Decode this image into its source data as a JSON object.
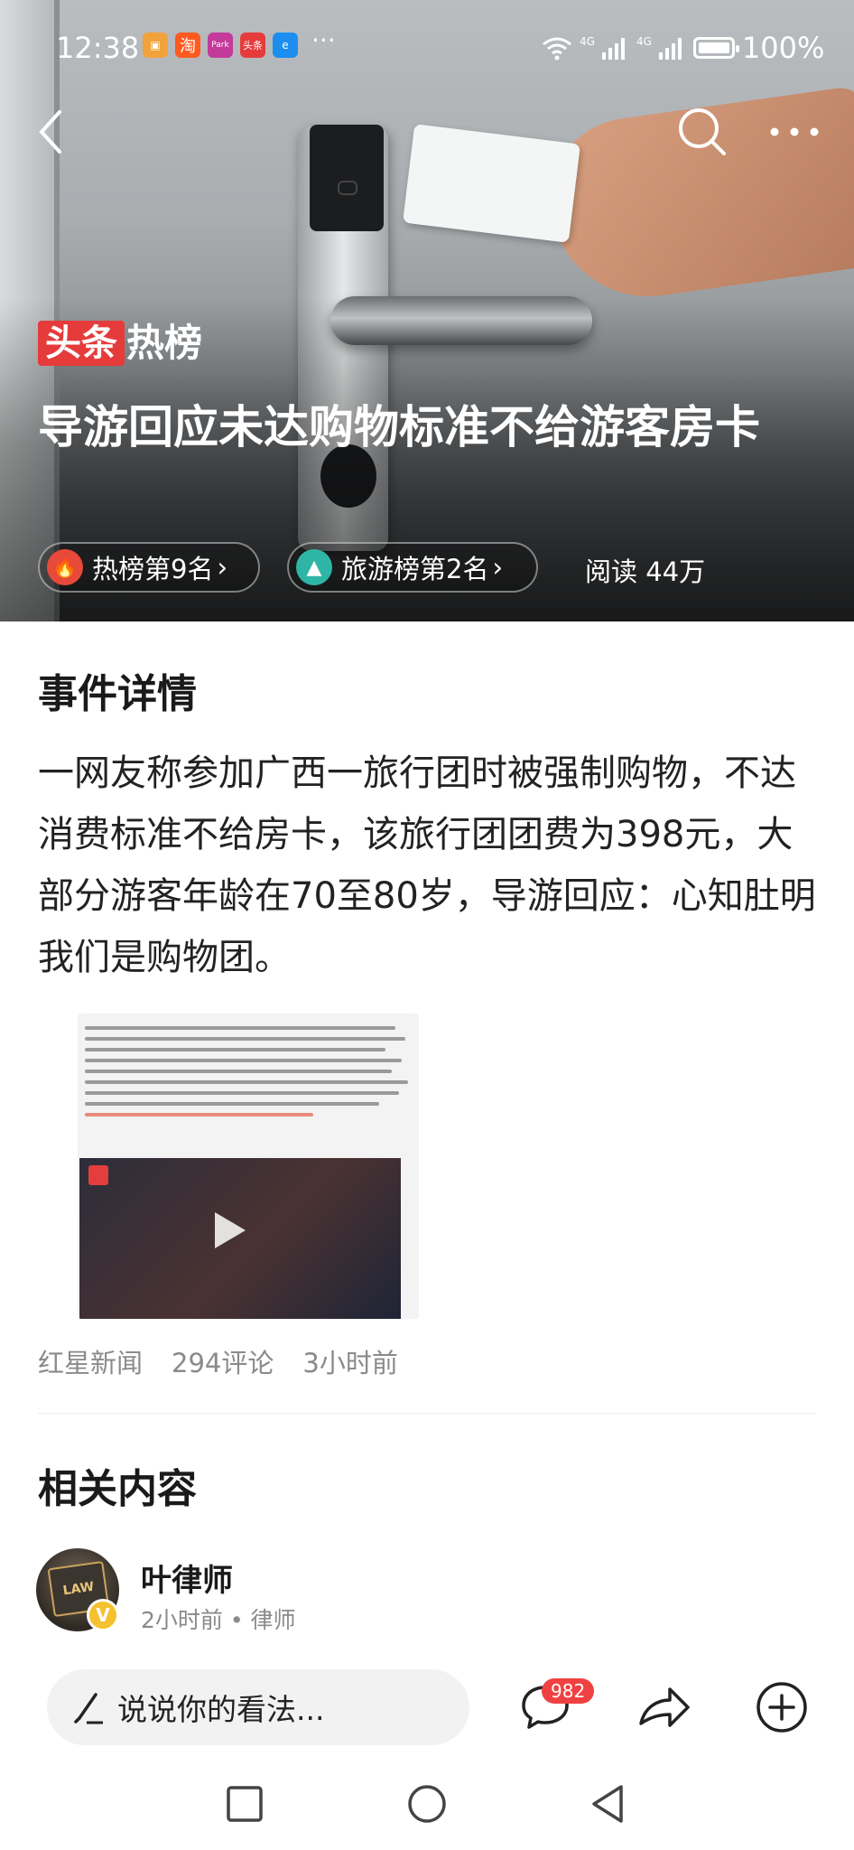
{
  "status_bar": {
    "time": "12:38",
    "apps": [
      "淘",
      "Park",
      "头条"
    ],
    "more": "···",
    "network_1": "4G",
    "network_2": "4G",
    "battery": "100%"
  },
  "header": {
    "back_icon": "back-chevron-icon",
    "search_icon": "search-icon",
    "more_icon": "more-dots-icon"
  },
  "hero": {
    "brand_badge": "头条",
    "brand_suffix": "热榜",
    "title": "导游回应未达购物标准不给游客房卡",
    "pill_hot": "热榜第9名",
    "pill_travel": "旅游榜第2名",
    "reads": "阅读 44万",
    "colors": {
      "brand_red": "#e63b3b",
      "hot_icon": "#e84a3a",
      "travel_icon": "#2fb5a6"
    }
  },
  "details": {
    "section_title": "事件详情",
    "text": "一网友称参加广西一旅行团时被强制购物，不达消费标准不给房卡，该旅行团团费为398元，大部分游客年龄在70至80岁，导游回应：心知肚明我们是购物团。",
    "source": "红星新闻",
    "comments": "294评论",
    "time": "3小时前"
  },
  "related": {
    "section_title": "相关内容",
    "author_name": "叶律师",
    "author_meta": "2小时前 • 律师",
    "avatar_text": "LAW",
    "verified": "V"
  },
  "bottom_bar": {
    "comment_placeholder": "说说你的看法...",
    "comment_count": "982",
    "icons": [
      "pencil-icon",
      "comment-icon",
      "share-icon",
      "add-icon"
    ]
  },
  "nav": {
    "icons": [
      "recents-square-icon",
      "home-circle-icon",
      "back-triangle-icon"
    ]
  }
}
